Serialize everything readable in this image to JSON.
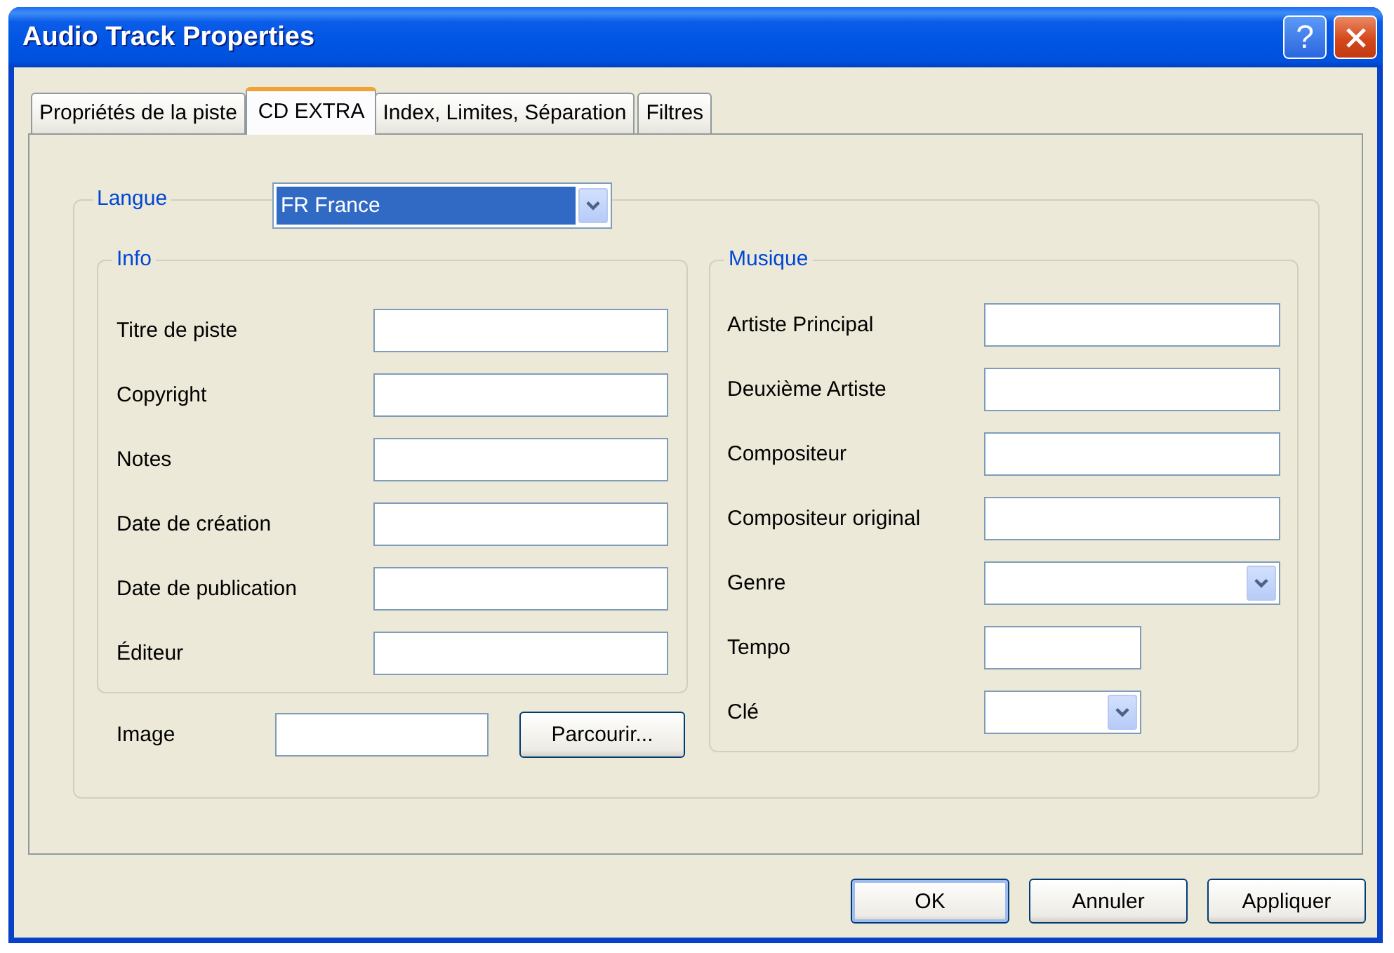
{
  "window": {
    "title": "Audio Track Properties",
    "title_buttons": [
      {
        "kind": "help",
        "glyph": "?"
      },
      {
        "kind": "close"
      }
    ]
  },
  "tabs": [
    {
      "label": "Propriétés de la piste",
      "selected": false
    },
    {
      "label": "CD EXTRA",
      "selected": true
    },
    {
      "label": "Index, Limites, Séparation",
      "selected": false
    },
    {
      "label": "Filtres",
      "selected": false
    }
  ],
  "language": {
    "label": "Langue",
    "value": "FR France",
    "focused": true
  },
  "info": {
    "title": "Info",
    "fields": [
      {
        "label": "Titre de piste",
        "kind": "text"
      },
      {
        "label": "Copyright",
        "kind": "text"
      },
      {
        "label": "Notes",
        "kind": "text"
      },
      {
        "label": "Date de création",
        "kind": "text"
      },
      {
        "label": "Date de publication",
        "kind": "text"
      },
      {
        "label": "Éditeur",
        "kind": "text"
      }
    ]
  },
  "image": {
    "label": "Image",
    "button": "Parcourir..."
  },
  "music": {
    "title": "Musique",
    "fields": [
      {
        "label": "Artiste Principal",
        "kind": "text"
      },
      {
        "label": "Deuxième Artiste",
        "kind": "text"
      },
      {
        "label": "Compositeur",
        "kind": "text"
      },
      {
        "label": "Compositeur original",
        "kind": "text"
      },
      {
        "label": "Genre",
        "kind": "combo"
      },
      {
        "label": "Tempo",
        "kind": "shorttext"
      },
      {
        "label": "Clé",
        "kind": "shortcombo"
      }
    ]
  },
  "buttons": [
    {
      "label": "OK",
      "default": true
    },
    {
      "label": "Annuler",
      "default": false
    },
    {
      "label": "Appliquer",
      "default": false
    }
  ]
}
